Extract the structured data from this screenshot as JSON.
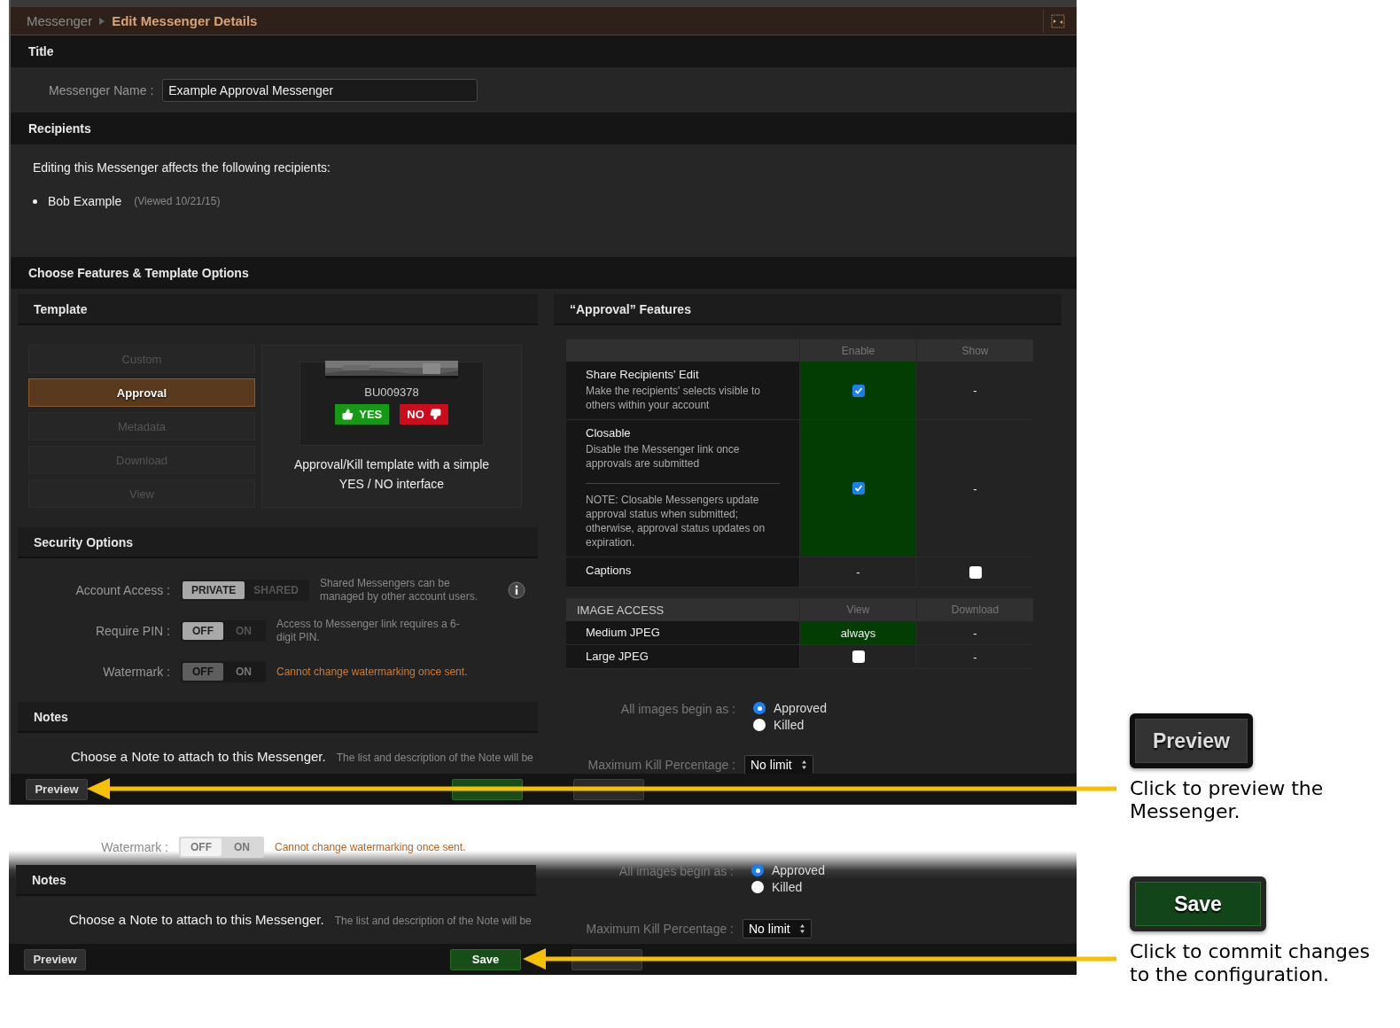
{
  "breadcrumb": [
    {
      "label": "Messenger",
      "current": false
    },
    {
      "label": "Edit Messenger Details",
      "current": true
    }
  ],
  "title_section": {
    "heading": "Title",
    "name_label": "Messenger Name :",
    "name_value": "Example Approval Messenger"
  },
  "recipients": {
    "heading": "Recipients",
    "intro": "Editing this Messenger affects the following recipients:",
    "list": [
      {
        "name": "Bob Example",
        "note": "(Viewed 10/21/15)"
      }
    ]
  },
  "features_heading": "Choose Features & Template Options",
  "template": {
    "heading": "Template",
    "options": [
      {
        "label": "Custom",
        "selected": false
      },
      {
        "label": "Approval",
        "selected": true
      },
      {
        "label": "Metadata",
        "selected": false
      },
      {
        "label": "Download",
        "selected": false
      },
      {
        "label": "View",
        "selected": false
      }
    ],
    "preview": {
      "code": "BU009378",
      "yes": "YES",
      "no": "NO",
      "description": "Approval/Kill template with a simple YES / NO interface"
    }
  },
  "security": {
    "heading": "Security Options",
    "rows": [
      {
        "label": "Account Access :",
        "options": [
          {
            "label": "PRIVATE",
            "selected": true
          },
          {
            "label": "SHARED",
            "selected": false
          }
        ],
        "hint": "Shared Messengers can be managed by other account users.",
        "disabled": false,
        "warning": false,
        "info": true
      },
      {
        "label": "Require PIN :",
        "options": [
          {
            "label": "OFF",
            "selected": true
          },
          {
            "label": "ON",
            "selected": false
          }
        ],
        "hint": "Access to Messenger link requires a 6-digit PIN.",
        "disabled": false,
        "warning": false
      },
      {
        "label": "Watermark :",
        "options": [
          {
            "label": "OFF",
            "selected": true
          },
          {
            "label": "ON",
            "selected": false
          }
        ],
        "hint": "Cannot change watermarking once sent.",
        "disabled": true,
        "warning": true
      }
    ]
  },
  "notes": {
    "heading": "Notes",
    "prompt": "Choose a Note to attach to this Messenger.",
    "hint": "The list and description of the Note will be"
  },
  "features": {
    "heading": "“Approval”  Features",
    "columns": [
      "Enable",
      "Show"
    ],
    "rows": [
      {
        "title": "Share Recipients' Edit",
        "description": "Make the recipients' selects visible to others within your account",
        "cells": [
          {
            "kind": "checkbox",
            "checked": true,
            "highlighted": true
          },
          {
            "kind": "text",
            "text": "-",
            "highlighted": false
          }
        ]
      },
      {
        "title": "Closable",
        "description": "Disable the Messenger link once approvals are submitted",
        "note": "NOTE: Closable Messengers update approval status when submitted; otherwise, approval status updates on expiration.",
        "cells": [
          {
            "kind": "checkbox",
            "checked": true,
            "highlighted": true
          },
          {
            "kind": "text",
            "text": "-",
            "highlighted": false
          }
        ]
      },
      {
        "title": "Captions",
        "cells": [
          {
            "kind": "text",
            "text": "-",
            "highlighted": false
          },
          {
            "kind": "checkbox",
            "checked": false,
            "highlighted": false
          }
        ]
      }
    ]
  },
  "image_access": {
    "label": "IMAGE ACCESS",
    "columns": [
      "View",
      "Download"
    ],
    "rows": [
      {
        "title": "Medium JPEG",
        "cells": [
          {
            "kind": "text",
            "text": "always",
            "highlighted": true
          },
          {
            "kind": "text",
            "text": "-",
            "highlighted": false
          }
        ]
      },
      {
        "title": "Large JPEG",
        "cells": [
          {
            "kind": "checkbox",
            "checked": false,
            "highlighted": false
          },
          {
            "kind": "text",
            "text": "-",
            "highlighted": false
          }
        ]
      }
    ]
  },
  "begin_as": {
    "label": "All images begin as :",
    "options": [
      {
        "label": "Approved",
        "selected": true
      },
      {
        "label": "Killed",
        "selected": false
      }
    ]
  },
  "max_kill": {
    "label": "Maximum Kill Percentage :",
    "value": "No limit"
  },
  "footer": {
    "buttons": [
      {
        "kind": "preview",
        "label": "Preview"
      },
      {
        "kind": "save"
      },
      {
        "kind": "plain"
      }
    ]
  },
  "detail_view": {
    "watermark": {
      "label": "Watermark :",
      "options": [
        {
          "label": "OFF",
          "selected": true
        },
        {
          "label": "ON",
          "selected": false
        }
      ],
      "hint": "Cannot change watermarking once sent.",
      "disabled": true,
      "warning": true
    },
    "notes": {
      "heading": "Notes",
      "prompt": "Choose a Note to attach to this Messenger.",
      "hint": "The list and description of the Note will be"
    },
    "begin_as": {
      "label": "All images begin as :",
      "options": [
        {
          "label": "Approved",
          "selected": true
        },
        {
          "label": "Killed",
          "selected": false
        }
      ]
    },
    "max_kill": {
      "label": "Maximum Kill Percentage :",
      "value": "No limit"
    },
    "footer": {
      "buttons": [
        {
          "kind": "preview",
          "label": "Preview"
        },
        {
          "kind": "save",
          "label": "Save"
        },
        {
          "kind": "plain"
        }
      ]
    }
  },
  "callouts": [
    {
      "kind": "preview",
      "button": "Preview",
      "text": "Click to preview the Messenger."
    },
    {
      "kind": "save",
      "button": "Save",
      "text": "Click to commit changes to the configuration."
    }
  ]
}
